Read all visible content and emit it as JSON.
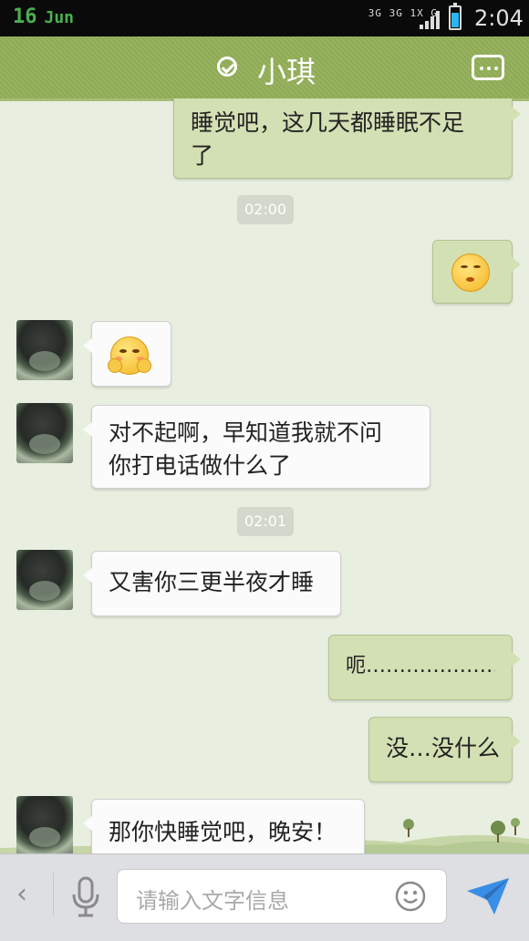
{
  "status_bar": {
    "date_day": "16",
    "date_month": "Jun",
    "network_labels": "3G 3G 1X G",
    "time": "2:04"
  },
  "header": {
    "contact_name": "小琪"
  },
  "messages": [
    {
      "type": "out_text",
      "text_line1": "睡觉吧，这几天都睡眠不足",
      "text_line2": "了"
    },
    {
      "type": "time",
      "text": "02:00"
    },
    {
      "type": "out_emoji",
      "emoji": "eye-roll-emoji"
    },
    {
      "type": "in_emoji",
      "emoji": "shy-emoji"
    },
    {
      "type": "in_text",
      "text_line1": "对不起啊，早知道我就不问",
      "text_line2": "你打电话做什么了"
    },
    {
      "type": "time",
      "text": "02:01"
    },
    {
      "type": "in_text",
      "text": "又害你三更半夜才睡"
    },
    {
      "type": "out_text",
      "text": "呃……………………"
    },
    {
      "type": "out_text",
      "text": "没…没什么"
    },
    {
      "type": "in_text",
      "text": "那你快睡觉吧，晚安！"
    }
  ],
  "input_bar": {
    "placeholder": "请输入文字信息"
  },
  "colors": {
    "header_green": "#8faa57",
    "outgoing_bubble": "#d3e0b4",
    "chat_background": "#e8efe0"
  }
}
